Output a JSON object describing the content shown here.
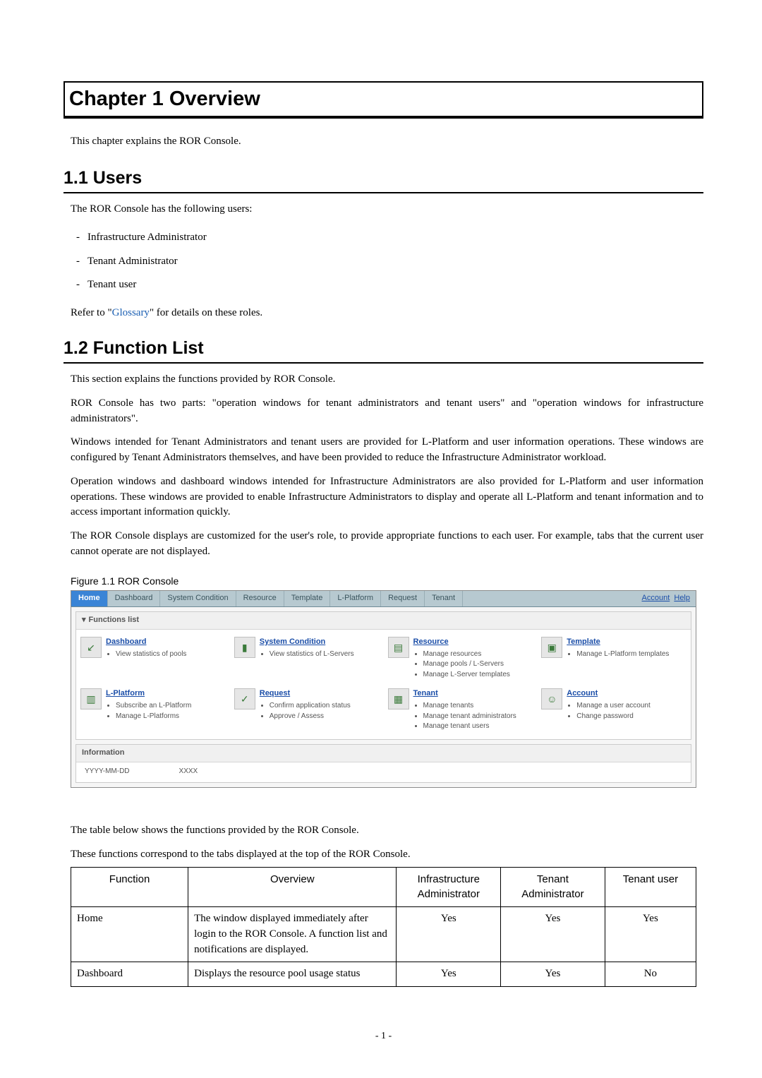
{
  "chapter": {
    "title": "Chapter 1 Overview"
  },
  "intro": "This chapter explains the ROR Console.",
  "section1": {
    "title": "1.1  Users",
    "lead": "The ROR Console has the following users:",
    "items": [
      "Infrastructure Administrator",
      "Tenant Administrator",
      "Tenant user"
    ],
    "refer_pre": "Refer to \"",
    "refer_link": "Glossary",
    "refer_post": "\" for details on these roles."
  },
  "section2": {
    "title": "1.2  Function List",
    "p1": "This section explains the functions provided by ROR Console.",
    "p2": "ROR Console has two parts: \"operation windows for tenant administrators and tenant users\" and \"operation windows for infrastructure administrators\".",
    "p3": "Windows intended for Tenant Administrators and tenant users are provided for L-Platform and user information operations. These windows are configured by Tenant Administrators themselves, and have been provided to reduce the Infrastructure Administrator workload.",
    "p4": "Operation windows and dashboard windows intended for Infrastructure Administrators are also provided for L-Platform and user information operations. These windows are provided to enable Infrastructure Administrators to display and operate all L-Platform and tenant information and to access important information quickly.",
    "p5": "The ROR Console displays are customized for the user's role, to provide appropriate functions to each user. For example, tabs that the current user cannot operate are not displayed.",
    "fig_caption": "Figure 1.1 ROR Console"
  },
  "ror": {
    "tabs": [
      "Home",
      "Dashboard",
      "System Condition",
      "Resource",
      "Template",
      "L-Platform",
      "Request",
      "Tenant"
    ],
    "active_tab": "Home",
    "right_links": {
      "account": "Account",
      "help": "Help"
    },
    "panel_title": "Functions list",
    "info_title": "Information",
    "info_date": "YYYY-MM-DD",
    "info_text": "XXXX",
    "items": [
      {
        "icon": "↙",
        "title": "Dashboard",
        "bullets": [
          "View statistics of pools"
        ]
      },
      {
        "icon": "▮",
        "title": "System Condition",
        "bullets": [
          "View statistics of L-Servers"
        ]
      },
      {
        "icon": "▤",
        "title": "Resource",
        "bullets": [
          "Manage resources",
          "Manage pools / L-Servers",
          "Manage L-Server templates"
        ]
      },
      {
        "icon": "▣",
        "title": "Template",
        "bullets": [
          "Manage L-Platform templates"
        ]
      },
      {
        "icon": "▥",
        "title": "L-Platform",
        "bullets": [
          "Subscribe an L-Platform",
          "Manage L-Platforms"
        ]
      },
      {
        "icon": "✓",
        "title": "Request",
        "bullets": [
          "Confirm application status",
          "Approve / Assess"
        ]
      },
      {
        "icon": "▦",
        "title": "Tenant",
        "bullets": [
          "Manage tenants",
          "Manage tenant administrators",
          "Manage tenant users"
        ]
      },
      {
        "icon": "☺",
        "title": "Account",
        "bullets": [
          "Manage a user account",
          "Change password"
        ]
      }
    ]
  },
  "after_fig": {
    "p6": "The table below shows the functions provided by the ROR Console.",
    "p7": "These functions correspond to the tabs displayed at the top of the ROR Console."
  },
  "table": {
    "headers": [
      "Function",
      "Overview",
      "Infrastructure Administrator",
      "Tenant Administrator",
      "Tenant user"
    ],
    "rows": [
      {
        "fn": "Home",
        "ov": "The window displayed immediately after login to the ROR Console. A function list and notifications are displayed.",
        "ia": "Yes",
        "ta": "Yes",
        "tu": "Yes"
      },
      {
        "fn": "Dashboard",
        "ov": "Displays the resource pool usage status",
        "ia": "Yes",
        "ta": "Yes",
        "tu": "No"
      }
    ]
  },
  "page_number": "- 1 -"
}
